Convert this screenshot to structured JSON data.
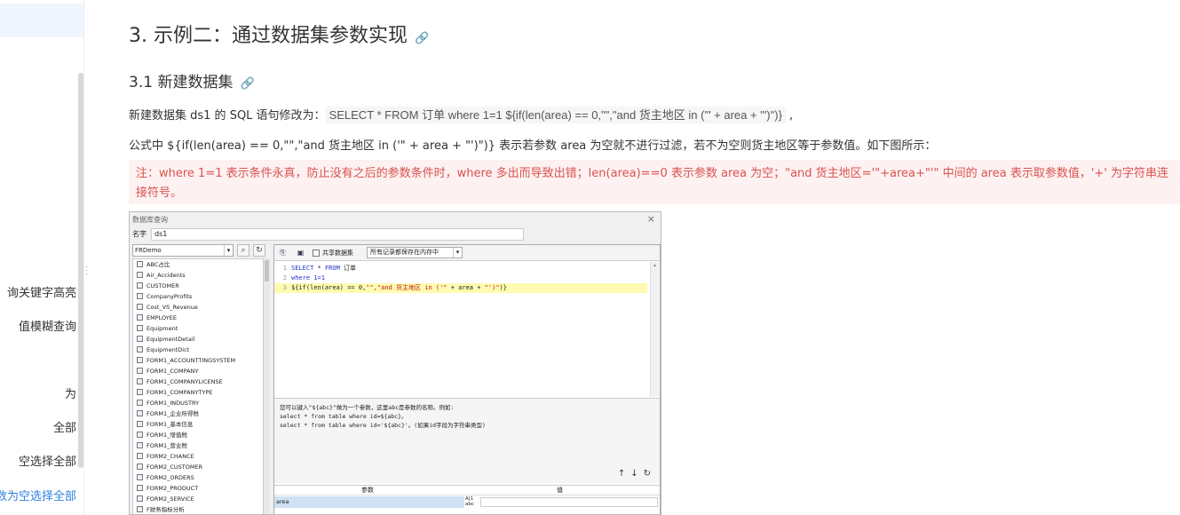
{
  "sidebar": {
    "items": [
      "询关键字高亮",
      "值模糊查询",
      "为",
      "全部",
      "空选择全部",
      "数为空选择全部"
    ]
  },
  "content": {
    "title": "3. 示例二：通过数据集参数实现",
    "subtitle": "3.1 新建数据集",
    "para1_prefix": "新建数据集 ds1 的 SQL 语句修改为：",
    "para1_code": "SELECT * FROM 订单 where 1=1  ${if(len(area) == 0,\"\",\"and 货主地区 in ('\" + area + \"')\")}",
    "para1_suffix": " ,",
    "para2": "公式中 ${if(len(area) == 0,\"\",\"and 货主地区 in ('\" + area + \"')\")} 表示若参数 area 为空就不进行过滤，若不为空则货主地区等于参数值。如下图所示：",
    "note": "注：where 1=1 表示条件永真，防止没有之后的参数条件时，where 多出而导致出错；len(area)==0 表示参数 area 为空；\"and 货主地区='\"+area+\"'\" 中间的 area 表示取参数值，'+' 为字符串连接符号。"
  },
  "dialog": {
    "title": "数据库查询",
    "close": "×",
    "name_label": "名字",
    "name_value": "ds1",
    "db_value": "FRDemo",
    "share_label": "共享数据集",
    "cache_mode": "所有记录都保存在内存中",
    "tables": [
      "ABC占比",
      "Air_Accidents",
      "CUSTOMER",
      "CompanyProfits",
      "Cost_VS_Revenue",
      "EMPLOYEE",
      "Equipment",
      "EquipmentDetail",
      "EquipmentDict",
      "FORM1_ACCOUNTTINGSYSTEM",
      "FORM1_COMPANY",
      "FORM1_COMPANYLICENSE",
      "FORM1_COMPANYTYPE",
      "FORM1_INDUSTRY",
      "FORM1_企业所得税",
      "FORM1_基本信息",
      "FORM1_增值税",
      "FORM1_营业税",
      "FORM2_CHANCE",
      "FORM2_CUSTOMER",
      "FORM2_ORDERS",
      "FORM2_PRODUCT",
      "FORM2_SERVICE",
      "F财务指标分析"
    ],
    "sql": {
      "line1_num": "1",
      "line1_kw1": "SELECT",
      "line1_mid": " * ",
      "line1_kw2": "FROM",
      "line1_tail": " 订单",
      "line2_num": "2",
      "line2_kw": "where",
      "line2_tail": " 1=1",
      "line3_num": "3",
      "line3_a": "${if(len(area) == 0,",
      "line3_str1": "\"\",\"and 货主地区 in ('\"",
      "line3_b": " + area + ",
      "line3_str2": "\"')\"",
      "line3_c": ")}"
    },
    "hint_line1": "您可以键入\"${abc}\"做为一个参数，这里abc是参数的名称。例如:",
    "hint_line2": "select * from table where id=${abc}。",
    "hint_line3": "select * from table where id='${abc}'。(如果id字段为字符串类型)",
    "param_col": "参数",
    "value_col": "值",
    "param_name": "area",
    "param_type": "A|1 abc"
  }
}
